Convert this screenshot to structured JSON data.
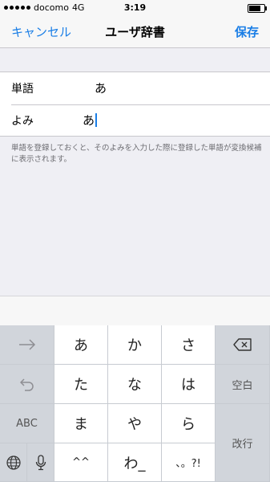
{
  "status_bar": {
    "carrier": "docomo",
    "network": "4G",
    "time": "3:19"
  },
  "nav": {
    "cancel_label": "キャンセル",
    "title": "ユーザ辞書",
    "save_label": "保存"
  },
  "form": {
    "word_label": "単語",
    "word_value": "あ",
    "reading_label": "よみ",
    "reading_value": "あ"
  },
  "footnote": "単語を登録しておくと、そのよみを入力した際に登録した単語が変換候補に表示されます。",
  "keyboard": {
    "row1": [
      "あ",
      "か",
      "さ"
    ],
    "row2": [
      "た",
      "な",
      "は"
    ],
    "row3": [
      "ま",
      "や",
      "ら"
    ],
    "row4": [
      "^^",
      "わ_",
      "、。?!"
    ],
    "abc_label": "ABC",
    "space_label": "空白",
    "return_label": "改行",
    "icons": {
      "next": "arrow-right-icon",
      "undo": "undo-icon",
      "delete": "delete-backspace-icon",
      "globe": "globe-icon",
      "mic": "microphone-icon"
    }
  },
  "colors": {
    "accent": "#1a7ee6",
    "background": "#efeff4",
    "keyboard_bg": "#d1d5db"
  }
}
